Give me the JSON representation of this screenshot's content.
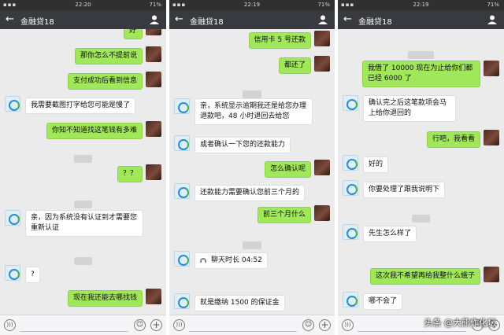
{
  "phones": [
    {
      "status_time": "22:20",
      "battery": "71%",
      "title": "金融贷18",
      "messages": [
        {
          "text": "好"
        },
        {
          "text": "那你怎么不提前说"
        },
        {
          "text": "支付成功后看到信息"
        },
        {
          "text": "我需要截图打字给您可能是慢了"
        },
        {
          "text": "你知不知道找这笔钱有多难"
        },
        {
          "text": "？？"
        },
        {
          "text": "亲，因为系统没有认证到才需要您重新认证"
        },
        {
          "text": "?"
        },
        {
          "text": "现在我还能去哪找钱"
        }
      ]
    },
    {
      "status_time": "22:19",
      "battery": "71%",
      "title": "金融贷18",
      "messages": [
        {
          "text": "信用卡 5 号还款"
        },
        {
          "text": "都还了"
        },
        {
          "text": "亲，系统显示逾期我还是给您办理退款吧，48 小时退回去给您"
        },
        {
          "text": "或者确认一下您的还款能力"
        },
        {
          "text": "怎么确认呢"
        },
        {
          "text": "还款能力需要确认您前三个月的"
        },
        {
          "text": "前三个月什么"
        },
        {
          "text": "聊天时长 04:52"
        },
        {
          "text": "就是缴纳 1500 的保证金"
        }
      ]
    },
    {
      "status_time": "22:19",
      "battery": "71%",
      "title": "金融贷18",
      "messages": [
        {
          "text": "我借了 10000 现在为止给你们都已经 6000 了"
        },
        {
          "text": "确认完之后这笔款项会马上给你退回的"
        },
        {
          "text": "行吧，我看看"
        },
        {
          "text": "好的"
        },
        {
          "text": "你要处理了跟我说明下"
        },
        {
          "text": "先生怎么样了"
        },
        {
          "text": "这次我不希望再给我整什么蛾子"
        },
        {
          "text": "哪不会了"
        }
      ]
    }
  ],
  "watermark": "头条 @大熊作化坛"
}
